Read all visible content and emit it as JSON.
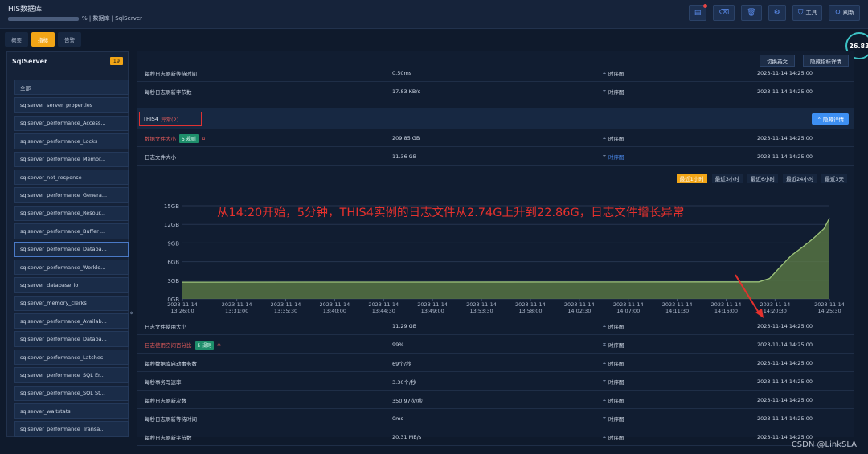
{
  "header": {
    "title": "HIS数据库",
    "breadcrumb_suffix": "% | 数据库 | SqlServer",
    "buttons": [
      {
        "icon": "doc-icon",
        "glyph": "▤",
        "label": ""
      },
      {
        "icon": "delete-icon",
        "glyph": "⌫",
        "label": ""
      },
      {
        "icon": "trash-icon",
        "glyph": "🗑",
        "label": ""
      },
      {
        "icon": "settings-icon",
        "glyph": "⚙",
        "label": ""
      },
      {
        "icon": "shield-icon",
        "glyph": "⛉",
        "label": "工具"
      },
      {
        "icon": "refresh-icon",
        "glyph": "↻",
        "label": "刷新"
      }
    ]
  },
  "tabs": [
    "概要",
    "指标",
    "告警"
  ],
  "active_tab": "指标",
  "gauge_value": "26.83",
  "sidebar": {
    "title": "SqlServer",
    "count": "19",
    "items": [
      "全部",
      "sqlserver_server_properties",
      "sqlserver_performance_Access...",
      "sqlserver_performance_Locks",
      "sqlserver_performance_Memor...",
      "sqlserver_net_response",
      "sqlserver_performance_Genera...",
      "sqlserver_performance_Resour...",
      "sqlserver_performance_Buffer ...",
      "sqlserver_performance_Databa...",
      "sqlserver_performance_Worklo...",
      "sqlserver_database_io",
      "sqlserver_memory_clerks",
      "sqlserver_performance_Availab...",
      "sqlserver_performance_Databa...",
      "sqlserver_performance_Latches",
      "sqlserver_performance_SQL Er...",
      "sqlserver_performance_SQL St...",
      "sqlserver_waitstats",
      "sqlserver_performance_Transa..."
    ],
    "selected_index": 9,
    "collapse_glyph": "«"
  },
  "main": {
    "buttons": [
      "切换英文",
      "隐藏指标详情"
    ],
    "top_rows": [
      {
        "name": "每秒日志刷新等待时间",
        "value": "0.50ms",
        "ts": "时序图",
        "time": "2023-11-14 14:25:00"
      },
      {
        "name": "每秒日志刷新字节数",
        "value": "17.83 KB/s",
        "ts": "时序图",
        "time": "2023-11-14 14:25:00"
      }
    ],
    "instance": {
      "name": "THIS4",
      "status": "异常(2)",
      "hide_label": "⌃ 隐藏详情"
    },
    "instance_rows": [
      {
        "name": "数据文件大小",
        "red": true,
        "tag": "5 规则",
        "value": "209.85 GB",
        "ts": "时序图",
        "link": false,
        "time": "2023-11-14 14:25:00"
      },
      {
        "name": "日志文件大小",
        "red": false,
        "tag": "",
        "value": "11.36 GB",
        "ts": "时序图",
        "link": true,
        "time": "2023-11-14 14:25:00"
      }
    ],
    "ranges": [
      "最近1小时",
      "最近3小时",
      "最近6小时",
      "最近24小时",
      "最近3天"
    ],
    "active_range": "最近1小时",
    "annotation": "从14:20开始，5分钟，THIS4实例的日志文件从2.74G上升到22.86G，日志文件增长异常",
    "bottom_rows": [
      {
        "name": "日志文件使用大小",
        "red": false,
        "tag": "",
        "value": "11.29 GB",
        "ts": "时序图",
        "time": "2023-11-14 14:25:00"
      },
      {
        "name": "日志使用空间百分比",
        "red": true,
        "tag": "5 规则",
        "value": "99%",
        "ts": "时序图",
        "time": "2023-11-14 14:25:00"
      },
      {
        "name": "每秒数据库启动事务数",
        "red": false,
        "tag": "",
        "value": "69个/秒",
        "ts": "时序图",
        "time": "2023-11-14 14:25:00"
      },
      {
        "name": "每秒事务写速率",
        "red": false,
        "tag": "",
        "value": "3.30个/秒",
        "ts": "时序图",
        "time": "2023-11-14 14:25:00"
      },
      {
        "name": "每秒日志刷新次数",
        "red": false,
        "tag": "",
        "value": "350.97次/秒",
        "ts": "时序图",
        "time": "2023-11-14 14:25:00"
      },
      {
        "name": "每秒日志刷新等待时间",
        "red": false,
        "tag": "",
        "value": "0ms",
        "ts": "时序图",
        "time": "2023-11-14 14:25:00"
      },
      {
        "name": "每秒日志刷新字节数",
        "red": false,
        "tag": "",
        "value": "20.31 MB/s",
        "ts": "时序图",
        "time": "2023-11-14 14:25:00"
      }
    ]
  },
  "watermark": "CSDN @LinkSLA",
  "colors": {
    "accent": "#f2a516",
    "line": "#9cc27a",
    "area": "#5f7f45",
    "annotation": "#e5312d",
    "primary": "#3d8ff2"
  },
  "chart_data": {
    "type": "area",
    "y_ticks": [
      "0GB",
      "3GB",
      "6GB",
      "9GB",
      "12GB",
      "15GB"
    ],
    "ylim": [
      0,
      15
    ],
    "x_tick_labels": [
      [
        "2023-11-14",
        "13:26:00"
      ],
      [
        "2023-11-14",
        "13:31:00"
      ],
      [
        "2023-11-14",
        "13:35:30"
      ],
      [
        "2023-11-14",
        "13:40:00"
      ],
      [
        "2023-11-14",
        "13:44:30"
      ],
      [
        "2023-11-14",
        "13:49:00"
      ],
      [
        "2023-11-14",
        "13:53:30"
      ],
      [
        "2023-11-14",
        "13:58:00"
      ],
      [
        "2023-11-14",
        "14:02:30"
      ],
      [
        "2023-11-14",
        "14:07:00"
      ],
      [
        "2023-11-14",
        "14:11:30"
      ],
      [
        "2023-11-14",
        "14:16:00"
      ],
      [
        "2023-11-14",
        "14:20:30"
      ],
      [
        "2023-11-14",
        "14:25:30"
      ]
    ],
    "series": [
      {
        "x": [
          "2023-11-14 13:26:00",
          "2023-11-14 14:19:00",
          "2023-11-14 14:20:00",
          "2023-11-14 14:21:00",
          "2023-11-14 14:22:00",
          "2023-11-14 14:23:00",
          "2023-11-14 14:24:00",
          "2023-11-14 14:25:00",
          "2023-11-14 14:25:30"
        ],
        "y": [
          2.7,
          2.74,
          3.3,
          5.2,
          7.0,
          8.3,
          9.7,
          11.3,
          13.0
        ]
      }
    ]
  }
}
